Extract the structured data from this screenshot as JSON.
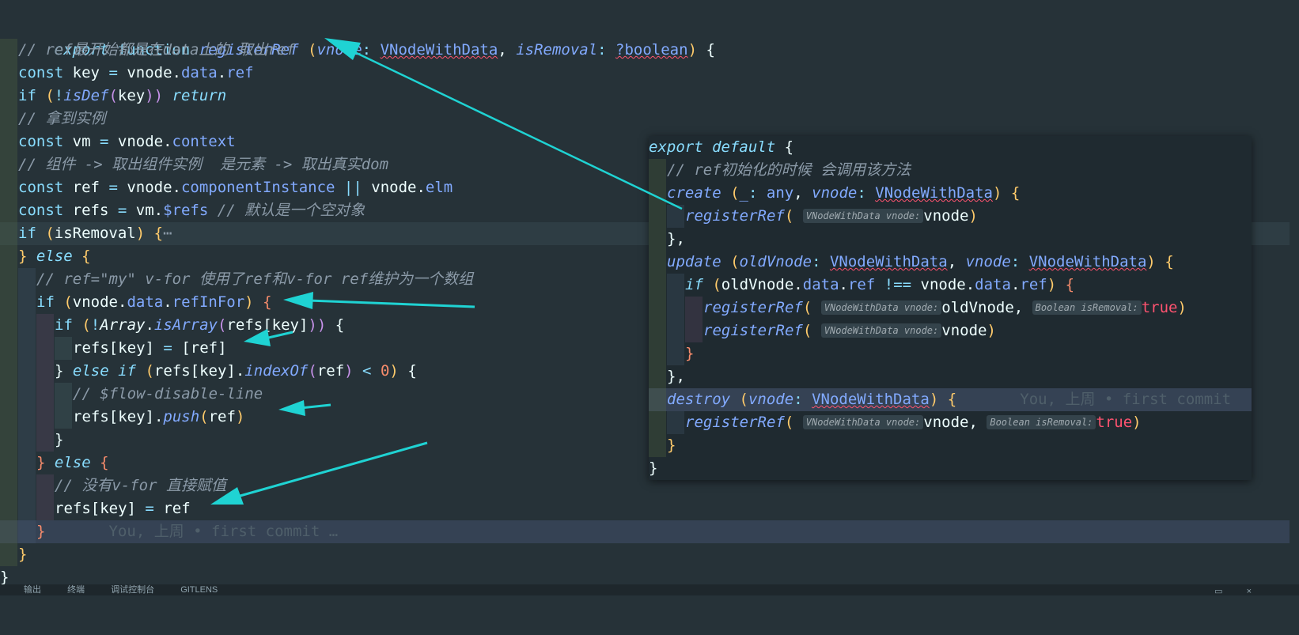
{
  "main_code": {
    "l1": {
      "a": "export",
      "b": "function",
      "c": "registerRef",
      "d": "(",
      "e": "vnode",
      "f": ":",
      "g": "VNodeWithData",
      "h": ",",
      "i": "isRemoval",
      "j": ":",
      "k": "?boolean",
      "l": ")",
      "m": "{"
    },
    "l2": {
      "a": "// ref最开始都是在data上的 取出ref"
    },
    "l3": {
      "a": "const",
      "b": "key",
      "c": "=",
      "d": "vnode.",
      "e": "data",
      "f": ".",
      "g": "ref"
    },
    "l4": {
      "a": "if",
      "b": "(",
      "c": "!",
      "d": "isDef",
      "e": "(",
      "f": "key",
      "g": "))",
      "h": "return"
    },
    "l5": {
      "a": "// 拿到实例"
    },
    "l6": {
      "a": "const",
      "b": "vm",
      "c": "=",
      "d": "vnode.",
      "e": "context"
    },
    "l7": {
      "a": "// 组件 -> 取出组件实例  是元素 -> 取出真实dom"
    },
    "l8": {
      "a": "const",
      "b": "ref",
      "c": "=",
      "d": "vnode.",
      "e": "componentInstance",
      "f": "||",
      "g": "vnode.",
      "h": "elm"
    },
    "l9": {
      "a": "const",
      "b": "refs",
      "c": "=",
      "d": "vm.",
      "e": "$refs",
      "f": "// 默认是一个空对象"
    },
    "l10": {
      "a": "if",
      "b": "(",
      "c": "isRemoval",
      "d": ")",
      "e": "{",
      "f": "⋯"
    },
    "l11": {
      "a": "}",
      "b": "else",
      "c": "{"
    },
    "l12": {
      "a": "// ref=\"my\" v-for 使用了ref和v-for ref维护为一个数组"
    },
    "l13": {
      "a": "if",
      "b": "(",
      "c": "vnode.",
      "d": "data",
      "e": ".",
      "f": "refInFor",
      "g": ")",
      "h": "{"
    },
    "l14": {
      "a": "if",
      "b": "(",
      "c": "!",
      "d": "Array",
      "e": ".",
      "f": "isArray",
      "g": "(",
      "h": "refs[key]",
      "i": "))",
      "j": "{"
    },
    "l15": {
      "a": "refs[key]",
      "b": "=",
      "c": "[ref]"
    },
    "l16": {
      "a": "}",
      "b": "else if",
      "c": "(",
      "d": "refs[key].",
      "e": "indexOf",
      "f": "(",
      "g": "ref",
      "h": ")",
      "i": "<",
      "j": "0",
      "k": ")",
      "l": "{"
    },
    "l17": {
      "a": "// $flow-disable-line"
    },
    "l18": {
      "a": "refs[key].",
      "b": "push",
      "c": "(",
      "d": "ref",
      "e": ")"
    },
    "l19": {
      "a": "}"
    },
    "l20": {
      "a": "}",
      "b": "else",
      "c": "{"
    },
    "l21": {
      "a": "// 没有v-for 直接赋值"
    },
    "l22": {
      "a": "refs[key]",
      "b": "=",
      "c": "ref"
    },
    "l23": {
      "a": "}",
      "b": "You, 上周 • first commit …"
    },
    "l24": {
      "a": "}"
    },
    "l25": {
      "a": "}"
    }
  },
  "popup_code": {
    "p1": {
      "a": "export",
      "b": "default",
      "c": "{"
    },
    "p2": {
      "a": "// ref初始化的时候 会调用该方法"
    },
    "p3": {
      "a": "create",
      "b": "(",
      "c": "_",
      "d": ":",
      "e": "any",
      "f": ",",
      "g": "vnode",
      "h": ":",
      "i": "VNodeWithData",
      "j": ")",
      "k": "{"
    },
    "p4": {
      "a": "registerRef",
      "b": "(",
      "c": "VNodeWithData vnode:",
      "d": "vnode",
      "e": ")"
    },
    "p5": {
      "a": "},"
    },
    "p6": {
      "a": "update",
      "b": "(",
      "c": "oldVnode",
      "d": ":",
      "e": "VNodeWithData",
      "f": ",",
      "g": "vnode",
      "h": ":",
      "i": "VNodeWithData",
      "j": ")",
      "k": "{"
    },
    "p7": {
      "a": "if",
      "b": "(",
      "c": "oldVnode.",
      "d": "data",
      "e": ".",
      "f": "ref",
      "g": "!==",
      "h": "vnode.",
      "i": "data",
      "j": ".",
      "k": "ref",
      "l": ")",
      "m": "{"
    },
    "p8": {
      "a": "registerRef",
      "b": "(",
      "c": "VNodeWithData vnode:",
      "d": "oldVnode",
      "e": ",",
      "f": "Boolean isRemoval:",
      "g": "true",
      "h": ")"
    },
    "p9": {
      "a": "registerRef",
      "b": "(",
      "c": "VNodeWithData vnode:",
      "d": "vnode",
      "e": ")"
    },
    "p10": {
      "a": "}"
    },
    "p11": {
      "a": "},"
    },
    "p12": {
      "a": "destroy",
      "b": "(",
      "c": "vnode",
      "d": ":",
      "e": "VNodeWithData",
      "f": ")",
      "g": "{",
      "h": "You, 上周 • first commit"
    },
    "p13": {
      "a": "registerRef",
      "b": "(",
      "c": "VNodeWithData vnode:",
      "d": "vnode",
      "e": ",",
      "f": "Boolean isRemoval:",
      "g": "true",
      "h": ")"
    },
    "p14": {
      "a": "}"
    },
    "p15": {
      "a": "}"
    }
  },
  "status_bar": {
    "items": [
      "输出",
      "终端",
      "调试控制台",
      "GITLENS"
    ]
  },
  "colors": {
    "background": "#263238",
    "popup_background": "#1f2a30",
    "arrow": "#1fd3d3",
    "keyword": "#89ddff",
    "function": "#82aaff",
    "comment": "#8b9aa8",
    "param_paren": "#ffcb6b",
    "boolean": "#ff5370",
    "number": "#f78c6c"
  }
}
